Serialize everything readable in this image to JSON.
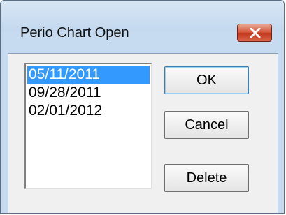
{
  "window": {
    "title": "Perio Chart Open",
    "close_icon": "close-x-icon"
  },
  "dates": {
    "items": [
      "05/11/2011",
      "09/28/2011",
      "02/01/2012"
    ],
    "selected_index": 0
  },
  "buttons": {
    "ok_label": "OK",
    "cancel_label": "Cancel",
    "delete_label": "Delete"
  },
  "colors": {
    "selection": "#3399ff",
    "close_button": "#c2371c",
    "frame": "#c6dbef",
    "client": "#f0f0f0"
  }
}
